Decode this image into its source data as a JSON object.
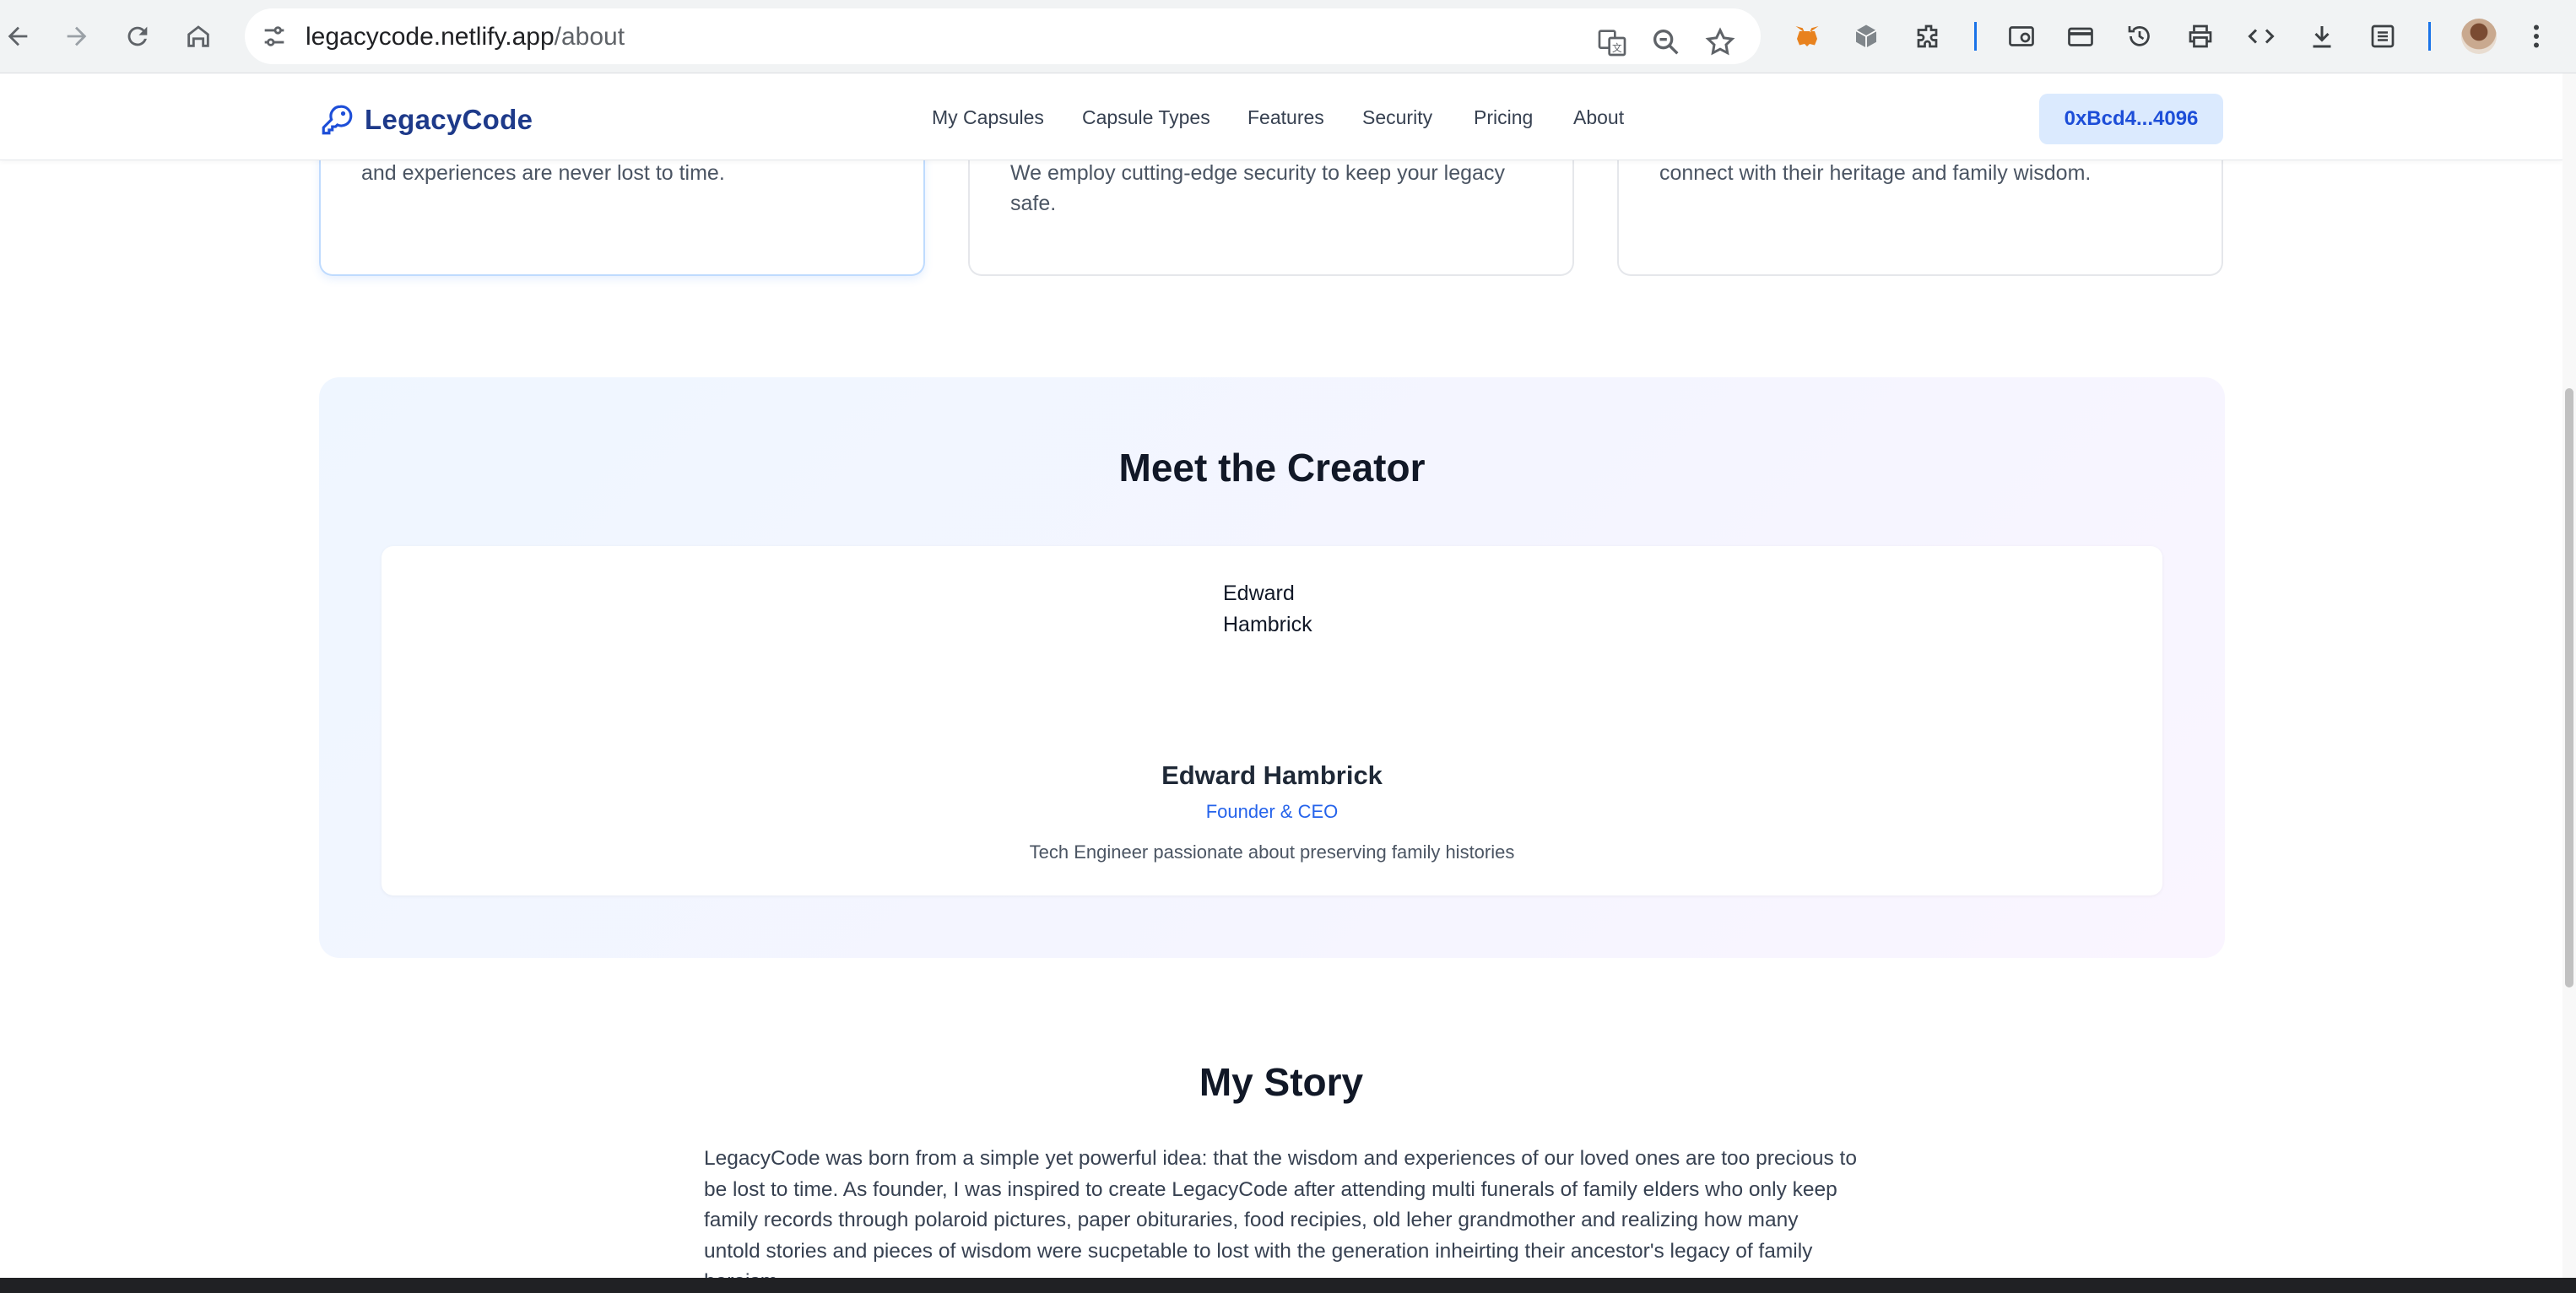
{
  "browser": {
    "url_host": "legacycode.netlify.app",
    "url_path": "/about"
  },
  "header": {
    "logo_text": "LegacyCode",
    "nav": [
      "My Capsules",
      "Capsule Types",
      "Features",
      "Security",
      "Pricing",
      "About"
    ],
    "wallet": "0xBcd4...4096"
  },
  "cards": [
    "We're committed to ensuring that valuable life lessons and experiences are never lost to time.",
    "Your memories deserve the highest level of protection. We employ cutting-edge security to keep your legacy safe.",
    "We create meaningful ways for future generations to connect with their heritage and family wisdom."
  ],
  "creator": {
    "title": "Meet the Creator",
    "avatar_alt": "Edward Hambrick",
    "name": "Edward Hambrick",
    "role": "Founder & CEO",
    "bio": "Tech Engineer passionate about preserving family histories"
  },
  "story": {
    "title": "My Story",
    "text": "LegacyCode was born from a simple yet powerful idea: that the wisdom and experiences of our loved ones are too precious to be lost to time. As founder, I was inspired to create LegacyCode after attending multi funerals of family elders who only keep family records through polaroid pictures, paper obituraries, food recipies, old leher grandmother and realizing how many untold stories and pieces of wisdom were sucpetable to lost with the generation inheirting their ancestor's legacy of family heroism."
  }
}
